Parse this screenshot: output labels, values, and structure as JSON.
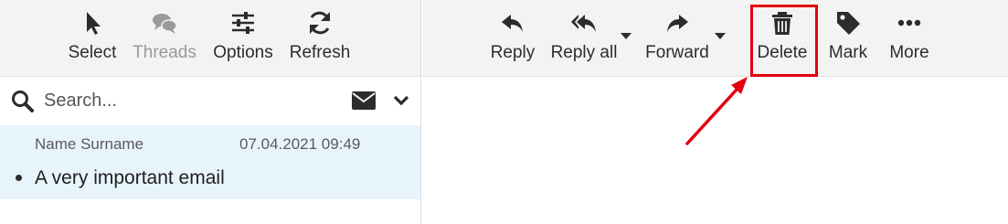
{
  "list_toolbar": {
    "select_label": "Select",
    "threads_label": "Threads",
    "options_label": "Options",
    "refresh_label": "Refresh"
  },
  "message_toolbar": {
    "reply_label": "Reply",
    "reply_all_label": "Reply all",
    "forward_label": "Forward",
    "delete_label": "Delete",
    "mark_label": "Mark",
    "more_label": "More"
  },
  "search": {
    "placeholder": "Search..."
  },
  "messages": [
    {
      "sender": "Name Surname",
      "date": "07.04.2021 09:49",
      "subject": "A very important email",
      "unread": true,
      "selected": true
    }
  ],
  "annotation": {
    "highlight_color": "#e3000f"
  },
  "colors": {
    "toolbar_bg": "#f3f3f3",
    "selected_row_bg": "#e8f4fb",
    "text": "#2c2c2c"
  }
}
